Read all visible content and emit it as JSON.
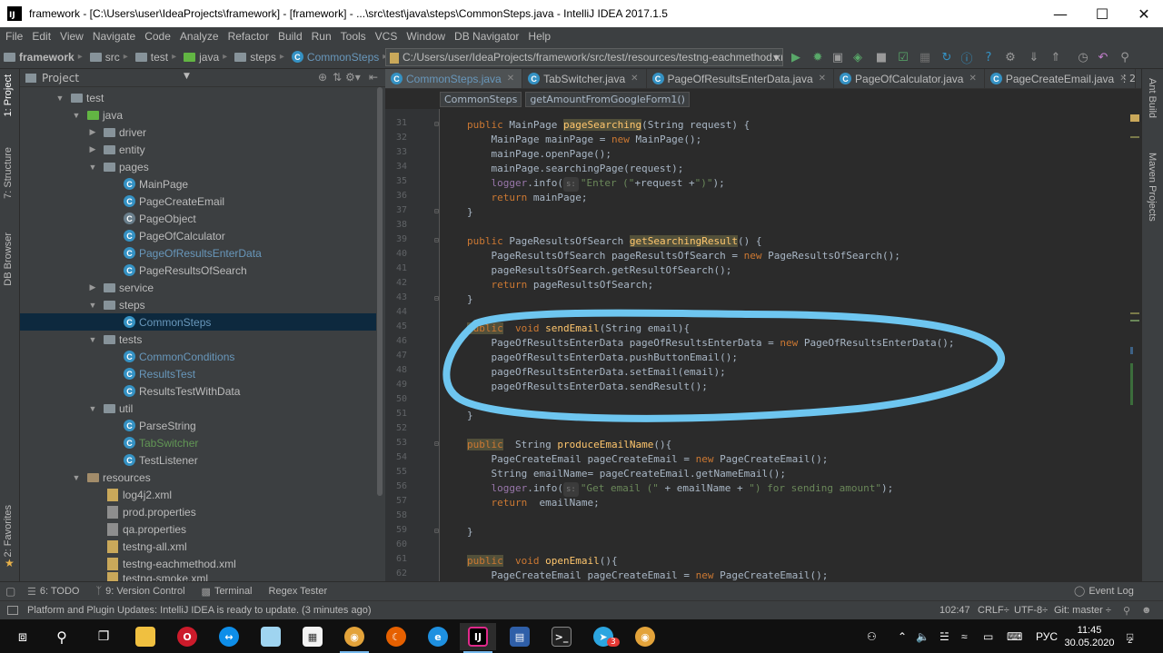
{
  "window": {
    "title": "framework - [C:\\Users\\user\\IdeaProjects\\framework] - [framework] - ...\\src\\test\\java\\steps\\CommonSteps.java - IntelliJ IDEA 2017.1.5"
  },
  "menu": [
    "File",
    "Edit",
    "View",
    "Navigate",
    "Code",
    "Analyze",
    "Refactor",
    "Build",
    "Run",
    "Tools",
    "VCS",
    "Window",
    "DB Navigator",
    "Help"
  ],
  "breadcrumbs": [
    "framework",
    "src",
    "test",
    "java",
    "steps",
    "CommonSteps"
  ],
  "run_config": "C:/Users/user/IdeaProjects/framework/src/test/resources/testng-eachmethod.xml",
  "left_strip": {
    "project": "1: Project",
    "structure": "7: Structure",
    "db_browser": "DB Browser",
    "favorites": "2: Favorites"
  },
  "project_panel": {
    "header": "Project",
    "tree": [
      {
        "label": "test",
        "kind": "folder"
      },
      {
        "label": "java",
        "kind": "folder-green"
      },
      {
        "label": "driver",
        "kind": "package"
      },
      {
        "label": "entity",
        "kind": "package"
      },
      {
        "label": "pages",
        "kind": "package"
      },
      {
        "label": "MainPage",
        "kind": "class"
      },
      {
        "label": "PageCreateEmail",
        "kind": "class"
      },
      {
        "label": "PageObject",
        "kind": "abstract"
      },
      {
        "label": "PageOfCalculator",
        "kind": "class"
      },
      {
        "label": "PageOfResultsEnterData",
        "kind": "class-modified"
      },
      {
        "label": "PageResultsOfSearch",
        "kind": "class"
      },
      {
        "label": "service",
        "kind": "package"
      },
      {
        "label": "steps",
        "kind": "package"
      },
      {
        "label": "CommonSteps",
        "kind": "class-modified"
      },
      {
        "label": "tests",
        "kind": "package"
      },
      {
        "label": "CommonConditions",
        "kind": "class-modified"
      },
      {
        "label": "ResultsTest",
        "kind": "class-modified"
      },
      {
        "label": "ResultsTestWithData",
        "kind": "class"
      },
      {
        "label": "util",
        "kind": "package"
      },
      {
        "label": "ParseString",
        "kind": "class"
      },
      {
        "label": "TabSwitcher",
        "kind": "class-green"
      },
      {
        "label": "TestListener",
        "kind": "class"
      },
      {
        "label": "resources",
        "kind": "resources"
      },
      {
        "label": "log4j2.xml",
        "kind": "xml"
      },
      {
        "label": "prod.properties",
        "kind": "prop"
      },
      {
        "label": "qa.properties",
        "kind": "prop"
      },
      {
        "label": "testng-all.xml",
        "kind": "xml"
      },
      {
        "label": "testng-eachmethod.xml",
        "kind": "xml"
      },
      {
        "label": "testng-smoke.xml",
        "kind": "xml"
      }
    ]
  },
  "editor_tabs": [
    "CommonSteps.java",
    "TabSwitcher.java",
    "PageOfResultsEnterData.java",
    "PageOfCalculator.java",
    "PageCreateEmail.java"
  ],
  "editor_tab_overflow": "⋮2",
  "editor_crumbs": [
    "CommonSteps",
    "getAmountFromGoogleForm1()"
  ],
  "code": {
    "line_numbers": [
      "31",
      "32",
      "33",
      "34",
      "35",
      "36",
      "37",
      "38",
      "39",
      "40",
      "41",
      "42",
      "43",
      "44",
      "45",
      "46",
      "47",
      "48",
      "49",
      "50",
      "51",
      "52",
      "53",
      "54",
      "55",
      "56",
      "57",
      "58",
      "59",
      "60",
      "61",
      "62"
    ],
    "l31_kw": "public",
    "l31_type": " MainPage ",
    "l31_fn": "pageSearching",
    "l31_rest": "(String request) {",
    "l32_a": "    MainPage mainPage = ",
    "l32_kw": "new",
    "l32_b": " MainPage();",
    "l33": "    mainPage.openPage();",
    "l34": "    mainPage.searchingPage(request);",
    "l35_field": "    logger",
    "l35_a": ".info(",
    "l35_hint": "s:",
    "l35_str": "\"Enter (\"",
    "l35_b": "+request +",
    "l35_str2": "\")\"",
    "l35_c": ");",
    "l36_kw": "    return",
    "l36_rest": " mainPage;",
    "l37": "}",
    "l39_kw": "public",
    "l39_type": " PageResultsOfSearch ",
    "l39_fn": "getSearchingResult",
    "l39_rest": "() {",
    "l40_a": "    PageResultsOfSearch pageResultsOfSearch = ",
    "l40_kw": "new",
    "l40_b": " PageResultsOfSearch();",
    "l41": "    pageResultsOfSearch.getResultOfSearch();",
    "l42_kw": "    return",
    "l42_rest": " pageResultsOfSearch;",
    "l43": "}",
    "l45_kw": "public",
    "l45_kw2": "void",
    "l45_fn": "sendEmail",
    "l45_rest": "(String email){",
    "l46_a": "    PageOfResultsEnterData pageOfResultsEnterData = ",
    "l46_kw": "new",
    "l46_b": " PageOfResultsEnterData();",
    "l47": "    pageOfResultsEnterData.pushButtonEmail();",
    "l48": "    pageOfResultsEnterData.setEmail(email);",
    "l49": "    pageOfResultsEnterData.sendResult();",
    "l51": "}",
    "l53_kw": "public",
    "l53_type": "  String ",
    "l53_fn": "produceEmailName",
    "l53_rest": "(){",
    "l54_a": "    PageCreateEmail pageCreateEmail = ",
    "l54_kw": "new",
    "l54_b": " PageCreateEmail();",
    "l55": "    String emailName= pageCreateEmail.getNameEmail();",
    "l56_field": "    logger",
    "l56_a": ".info(",
    "l56_hint": "s:",
    "l56_str": "\"Get email (\"",
    "l56_b": " + emailName + ",
    "l56_str2": "\") for sending amount\"",
    "l56_c": ");",
    "l57_kw": "    return",
    "l57_rest": "  emailName;",
    "l59": "}",
    "l61_kw": "public",
    "l61_kw2": "void",
    "l61_fn": "openEmail",
    "l61_rest": "(){",
    "l62_a": "    PageCreateEmail pageCreateEmail = ",
    "l62_kw": "new",
    "l62_b": " PageCreateEmail();"
  },
  "right_strip": {
    "ant": "Ant Build",
    "maven": "Maven Projects"
  },
  "bottom_tools": [
    "6: TODO",
    "9: Version Control",
    "Terminal",
    "Regex Tester"
  ],
  "event_log": "Event Log",
  "status": {
    "message": "Platform and Plugin Updates: IntelliJ IDEA is ready to update. (3 minutes ago)",
    "position": "102:47",
    "line_sep": "CRLF÷",
    "encoding": "UTF-8÷",
    "git": "Git: master ÷"
  },
  "taskbar": {
    "lang": "РУС",
    "time": "11:45",
    "date": "30.05.2020",
    "notif_count": "2",
    "telegram_badge": "3"
  },
  "colors": {
    "annotation": "#6ec6f0",
    "accent": "#6897bb"
  }
}
